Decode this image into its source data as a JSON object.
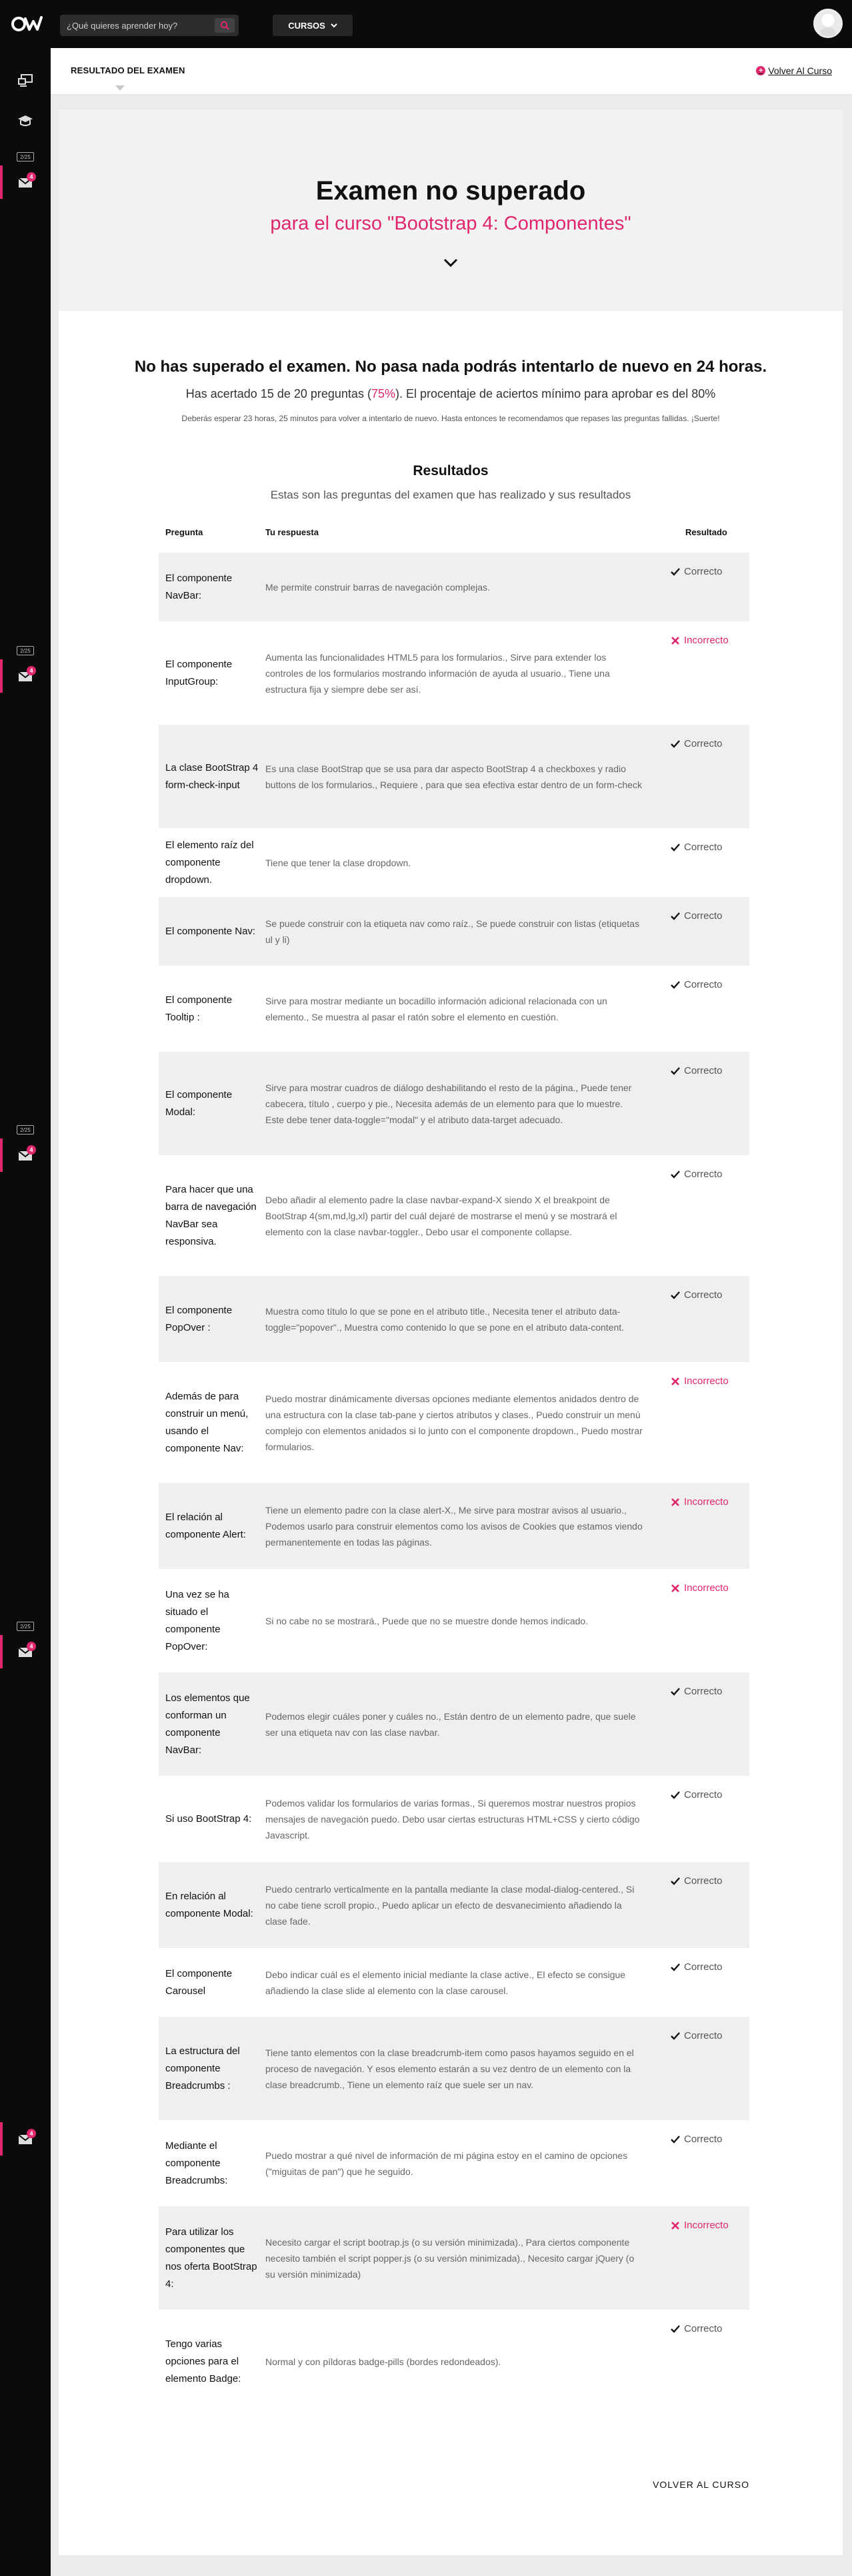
{
  "header": {
    "search_placeholder": "¿Qué quieres aprender hoy?",
    "courses_label": "CURSOS"
  },
  "sidebar": {
    "badge_count": "4",
    "chip_label": "2/25"
  },
  "breadcrumb": {
    "current": "RESULTADO DEL EXAMEN",
    "back_link": "Volver Al Curso"
  },
  "hero": {
    "title": "Examen no superado",
    "subtitle": "para el curso \"Bootstrap 4: Componentes\""
  },
  "summary": {
    "verdict": "No has superado el examen. No pasa nada podrás intentarlo de nuevo en 24 horas.",
    "score_prefix": "Has acertado 15 de 20 preguntas (",
    "score_pct": "75%",
    "score_suffix": "). El procentaje de aciertos mínimo para aprobar es del 80%",
    "note": "Deberás esperar 23 horas, 25 minutos para volver a intentarlo de nuevo. Hasta entonces te recomendamos que repases las preguntas fallidas. ¡Suerte!"
  },
  "results": {
    "title": "Resultados",
    "subtitle": "Estas son las preguntas del examen que has realizado y sus resultados",
    "columns": {
      "question": "Pregunta",
      "answer": "Tu respuesta",
      "result": "Resultado"
    },
    "label_ok": "Correcto",
    "label_bad": "Incorrecto",
    "rows": [
      {
        "question": "El componente NavBar:",
        "answer": "Me permite construir barras de navegación complejas.",
        "correct": true
      },
      {
        "question": "El componente InputGroup:",
        "answer": "Aumenta las funcionalidades HTML5 para los formularios., Sirve para extender los controles de los formularios mostrando información de ayuda al usuario., Tiene una estructura fija y siempre debe ser así.",
        "correct": false
      },
      {
        "question": "La clase BootStrap 4 form-check-input",
        "answer": "Es una clase BootStrap que se usa para dar aspecto BootStrap 4 a checkboxes y radio buttons de los formularios., Requiere , para que sea efectiva estar dentro de un form-check",
        "correct": true
      },
      {
        "question": "El elemento raíz del componente dropdown.",
        "answer": "Tiene que tener la clase dropdown.",
        "correct": true
      },
      {
        "question": "El componente Nav:",
        "answer": "Se puede construir con la etiqueta nav como raíz., Se puede construir con listas (etiquetas ul y li)",
        "correct": true
      },
      {
        "question": "El componente Tooltip :",
        "answer": "Sirve para mostrar mediante un bocadillo información adicional relacionada con un elemento., Se muestra al pasar el ratón sobre el elemento en cuestión.",
        "correct": true
      },
      {
        "question": "El componente Modal:",
        "answer": "Sirve para mostrar cuadros de diálogo deshabilitando el resto de la página., Puede tener cabecera, título , cuerpo y pie., Necesita además de un elemento para que lo muestre. Este debe tener data-toggle=\"modal\" y el atributo data-target adecuado.",
        "correct": true
      },
      {
        "question": "Para hacer que una barra de navegación NavBar sea responsiva.",
        "answer": "Debo añadir al elemento padre la clase navbar-expand-X siendo X el breakpoint de BootStrap 4(sm,md,lg,xl) partir del cuál dejaré de mostrarse el menú y se mostrará el elemento con la clase navbar-toggler., Debo usar el componente collapse.",
        "correct": true
      },
      {
        "question": "El componente PopOver :",
        "answer": "Muestra como título lo que se pone en el atributo title., Necesita tener el atributo data-toggle=\"popover\"., Muestra como contenido lo que se pone en el atributo data-content.",
        "correct": true
      },
      {
        "question": "Además de para construir un menú, usando el componente Nav:",
        "answer": "Puedo mostrar dinámicamente diversas opciones mediante elementos anidados dentro de una estructura con la clase tab-pane y ciertos atributos y clases., Puedo construir un menú complejo con elementos anidados si lo junto con el componente dropdown., Puedo mostrar formularios.",
        "correct": false
      },
      {
        "question": "El relación al componente Alert:",
        "answer": "Tiene un elemento padre con la clase alert-X., Me sirve para mostrar avisos al usuario., Podemos usarlo para construir elementos como los avisos de Cookies que estamos viendo permanentemente en todas las páginas.",
        "correct": false
      },
      {
        "question": "Una vez se ha situado el componente PopOver:",
        "answer": "Si no cabe no se mostrará., Puede que no se muestre donde hemos indicado.",
        "correct": false
      },
      {
        "question": "Los elementos que conforman un componente NavBar:",
        "answer": "Podemos elegir cuáles poner y cuáles no., Están dentro de un elemento padre, que suele ser una etiqueta nav con las clase navbar.",
        "correct": true
      },
      {
        "question": "Si uso BootStrap 4:",
        "answer": "Podemos validar los formularios de varias formas., Si queremos mostrar nuestros propios mensajes de navegación puedo. Debo usar ciertas estructuras HTML+CSS y cierto código Javascript.",
        "correct": true
      },
      {
        "question": "En relación al componente Modal:",
        "answer": "Puedo centrarlo verticalmente en la pantalla mediante la clase modal-dialog-centered., Si no cabe tiene scroll propio., Puedo aplicar un efecto de desvanecimiento añadiendo la clase fade.",
        "correct": true
      },
      {
        "question": "El componente Carousel",
        "answer": "Debo indicar cuál es el elemento inicial mediante la clase active., El efecto se consigue añadiendo la clase slide al elemento con la clase carousel.",
        "correct": true
      },
      {
        "question": "La estructura del componente Breadcrumbs :",
        "answer": "Tiene tanto elementos con la clase breadcrumb-item como pasos hayamos seguido en el proceso de navegación. Y esos elemento estarán a su vez dentro de un elemento con la clase breadcrumb., Tiene un elemento raíz que suele ser un nav.",
        "correct": true
      },
      {
        "question": "Mediante el componente Breadcrumbs:",
        "answer": "Puedo mostrar a qué nivel de información de mi página estoy en el camino de opciones (\"miguitas de pan\") que he seguido.",
        "correct": true
      },
      {
        "question": "Para utilizar los componentes que nos oferta BootStrap 4:",
        "answer": "Necesito cargar el script bootrap.js (o su versión minimizada)., Para ciertos componente necesito también el script popper.js (o su versión minimizada)., Necesito cargar jQuery (o su versión minimizada)",
        "correct": false
      },
      {
        "question": "Tengo varias opciones para el elemento Badge:",
        "answer": "Normal y con píldoras badge-pills (bordes redondeados).",
        "correct": true
      }
    ]
  },
  "footer": {
    "back_label": "VOLVER AL CURSO"
  },
  "colors": {
    "accent": "#e0266d",
    "topbar": "#0b0b0b",
    "row_alt": "#efefef"
  }
}
